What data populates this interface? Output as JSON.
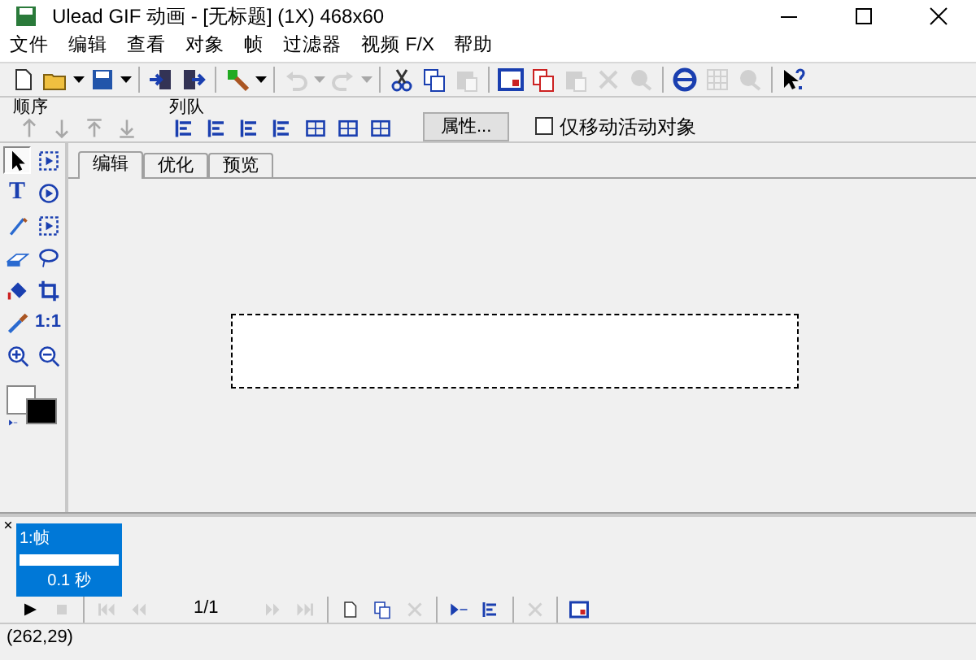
{
  "window": {
    "title": "Ulead GIF 动画 - [无标题] (1X) 468x60"
  },
  "menu": [
    "文件",
    "编辑",
    "查看",
    "对象",
    "帧",
    "过滤器",
    "视频 F/X",
    "帮助"
  ],
  "toolbar": [
    {
      "kind": "button",
      "disabled": false
    },
    {
      "kind": "dropdown",
      "disabled": false
    },
    {
      "kind": "dropdown",
      "disabled": false
    },
    {
      "kind": "separator"
    },
    {
      "kind": "button",
      "disabled": false
    },
    {
      "kind": "button",
      "disabled": false
    },
    {
      "kind": "separator"
    },
    {
      "kind": "dropdown",
      "disabled": false
    },
    {
      "kind": "separator"
    },
    {
      "kind": "dropdown",
      "disabled": true
    },
    {
      "kind": "dropdown",
      "disabled": true
    },
    {
      "kind": "separator"
    },
    {
      "kind": "button",
      "disabled": false
    },
    {
      "kind": "button",
      "disabled": false
    },
    {
      "kind": "button",
      "disabled": true
    },
    {
      "kind": "separator"
    },
    {
      "kind": "button",
      "disabled": false
    },
    {
      "kind": "button",
      "disabled": false
    },
    {
      "kind": "button",
      "disabled": true
    },
    {
      "kind": "button",
      "disabled": true
    },
    {
      "kind": "button",
      "disabled": true
    },
    {
      "kind": "separator"
    },
    {
      "kind": "button",
      "disabled": false
    },
    {
      "kind": "button",
      "disabled": true
    },
    {
      "kind": "button",
      "disabled": true
    },
    {
      "kind": "separator"
    },
    {
      "kind": "button",
      "disabled": false
    }
  ],
  "order": {
    "label": "顺序",
    "buttons": [
      {
        "disabled": true
      },
      {
        "disabled": true
      },
      {
        "disabled": true
      },
      {
        "disabled": true
      }
    ]
  },
  "queue": {
    "label": "列队",
    "buttons": [
      {
        "disabled": false
      },
      {
        "disabled": false
      },
      {
        "disabled": false
      },
      {
        "disabled": false
      },
      {
        "disabled": false
      },
      {
        "disabled": false
      },
      {
        "disabled": false
      }
    ]
  },
  "properties_button": "属性...",
  "move_active_only": {
    "label": "仅移动活动对象",
    "checked": false
  },
  "tools": [
    {
      "selected": true
    },
    {
      "selected": false
    },
    {
      "selected": false,
      "glyph": "T"
    },
    {
      "selected": false
    },
    {
      "selected": false
    },
    {
      "selected": false
    },
    {
      "selected": false
    },
    {
      "selected": false
    },
    {
      "selected": false
    },
    {
      "selected": false
    },
    {
      "selected": false
    },
    {
      "selected": false,
      "glyph": "1:1"
    },
    {
      "selected": false
    },
    {
      "selected": false
    }
  ],
  "swatches": [
    {
      "color": "#ffffff"
    },
    {
      "color": "#000000"
    }
  ],
  "tabs": [
    {
      "label": "编辑",
      "selected": true
    },
    {
      "label": "优化",
      "selected": false
    },
    {
      "label": "预览",
      "selected": false
    }
  ],
  "frames": [
    {
      "label": "1:帧",
      "delay": "0.1 秒",
      "selected": true
    }
  ],
  "player": {
    "counter": "1/1",
    "buttons": [
      {
        "disabled": false
      },
      {
        "disabled": true
      },
      {
        "kind": "separator"
      },
      {
        "disabled": true
      },
      {
        "disabled": true
      },
      {
        "kind": "counter"
      },
      {
        "disabled": true
      },
      {
        "disabled": true
      },
      {
        "kind": "separator"
      },
      {
        "disabled": false
      },
      {
        "disabled": false
      },
      {
        "disabled": true
      },
      {
        "kind": "separator"
      },
      {
        "disabled": false
      },
      {
        "disabled": false
      },
      {
        "kind": "separator"
      },
      {
        "disabled": true
      },
      {
        "kind": "separator"
      },
      {
        "disabled": false
      }
    ]
  },
  "status_bar": "(262,29)"
}
